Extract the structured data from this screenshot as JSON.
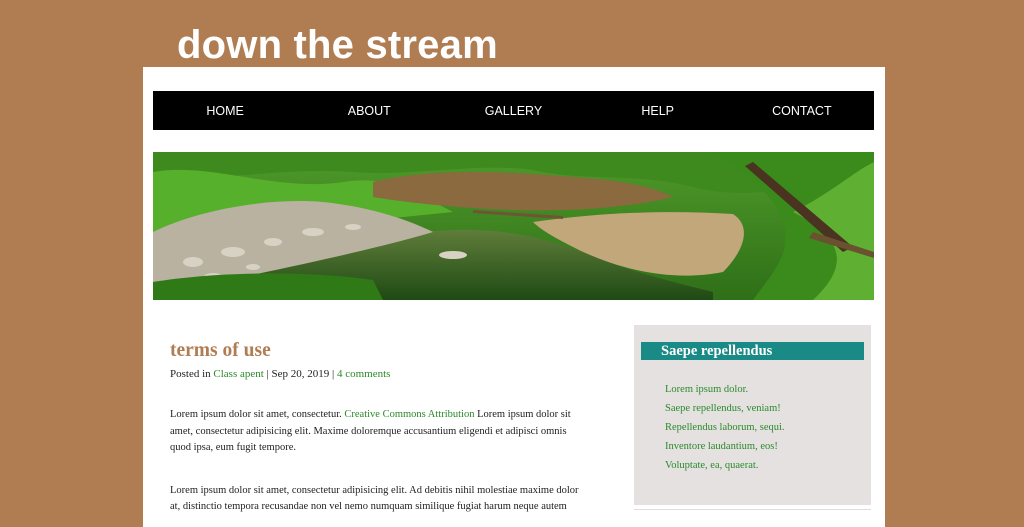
{
  "site": {
    "title": "down the stream"
  },
  "nav": {
    "items": [
      "HOME",
      "ABOUT",
      "GALLERY",
      "HELP",
      "CONTACT"
    ]
  },
  "post": {
    "title": "terms of use",
    "meta": {
      "posted_in": "Posted in",
      "category": "Class apent",
      "separator1": "|",
      "date": "Sep 20, 2019",
      "separator2": "|",
      "comments": "4 comments"
    },
    "paragraph1": {
      "before": "Lorem ipsum dolor sit amet, consectetur.",
      "link": "Creative Commons Attribution",
      "after": "Lorem ipsum dolor sit amet, consectetur adipisicing elit. Maxime doloremque accusantium eligendi et adipisci omnis quod ipsa, eum fugit tempore."
    },
    "paragraph2": "Lorem ipsum dolor sit amet, consectetur adipisicing elit. Ad debitis nihil molestiae maxime dolor at, distinctio tempora recusandae non vel nemo numquam similique fugiat harum neque autem"
  },
  "sidebar": {
    "title": "Saepe repellendus",
    "links": [
      "Lorem ipsum dolor.",
      "Saepe repellendus, veniam!",
      "Repellendus laborum, sequi.",
      "Inventore laudantium, eos!",
      "Voluptate, ea, quaerat."
    ]
  },
  "colors": {
    "background": "#b07d52",
    "nav_bg": "#000000",
    "accent_title": "#b07d52",
    "link_green": "#2a8a2a",
    "widget_header": "#1a8a86",
    "sidebar_bg": "#e6e1e1"
  }
}
